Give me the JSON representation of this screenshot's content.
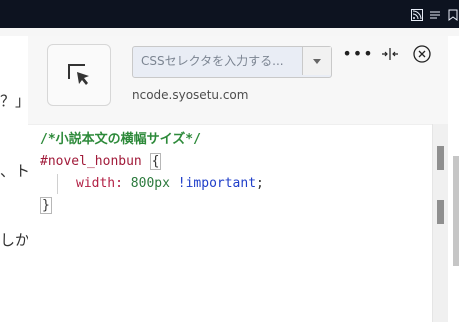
{
  "background_text": {
    "line1": "？」",
    "line2": "、ト",
    "line3": "しか"
  },
  "panel": {
    "selector_placeholder": "CSSセレクタを入力する...",
    "url": "ncode.syosetu.com",
    "actions": {
      "more_label": "•••"
    }
  },
  "editor": {
    "comment": "/*小説本文の横幅サイズ*/",
    "selector": "#novel_honbun",
    "open_brace": "{",
    "property": "width:",
    "value": "800px",
    "important": "!important",
    "semicolon": ";",
    "close_brace": "}"
  },
  "colors": {
    "topbar": "#0d1320",
    "panel_bg": "#f7f7f7",
    "comment": "#2d8a3a",
    "selector": "#a11b3a",
    "property": "#b22145",
    "value": "#2c7a3d",
    "important": "#1f3ec9"
  },
  "icons": [
    "rss-icon",
    "list-icon",
    "bookmark-icon",
    "element-picker-icon",
    "more-options-icon",
    "resize-width-icon",
    "close-icon",
    "dropdown-caret-icon"
  ]
}
